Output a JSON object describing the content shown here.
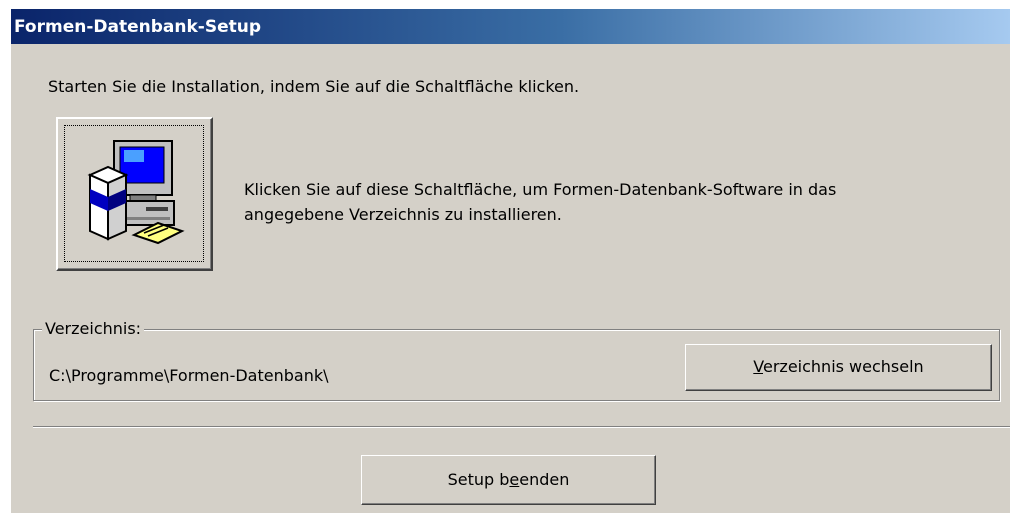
{
  "window": {
    "title": "Formen-Datenbank-Setup"
  },
  "main": {
    "instruction": "Starten Sie die Installation, indem Sie auf die Schaltfläche klicken.",
    "install_icon": "setup-computer-icon",
    "description_line1": "Klicken Sie auf diese Schaltfläche, um Formen-Datenbank-Software in das",
    "description_line2": "angegebene Verzeichnis zu installieren."
  },
  "directory": {
    "legend": "Verzeichnis:",
    "path": "C:\\Programme\\Formen-Datenbank\\",
    "change_button": {
      "mnemonic": "V",
      "rest": "erzeichnis wechseln"
    }
  },
  "footer": {
    "finish_button": {
      "before": "Setup b",
      "mnemonic": "e",
      "after": "enden"
    }
  }
}
